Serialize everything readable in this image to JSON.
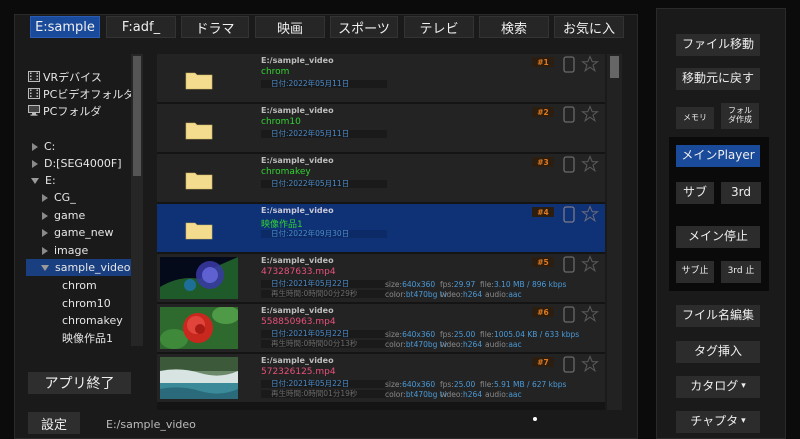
{
  "tabs": [
    {
      "label": "E:sample",
      "active": true
    },
    {
      "label": "F:adf_",
      "active": false
    },
    {
      "label": "ドラマ",
      "active": false
    },
    {
      "label": "映画",
      "active": false
    },
    {
      "label": "スポーツ",
      "active": false
    },
    {
      "label": "テレビ",
      "active": false
    },
    {
      "label": "検索",
      "active": false
    },
    {
      "label": "お気に入",
      "active": false
    }
  ],
  "tree": {
    "devices": [
      {
        "label": "VRデバイス",
        "icon": "film-icon"
      },
      {
        "label": "PCビデオフォルダ",
        "icon": "film-icon"
      },
      {
        "label": "PCフォルダ",
        "icon": "monitor-icon"
      }
    ],
    "drives": [
      "C:",
      "D:[SEG4000F]",
      "E:"
    ],
    "e_children": [
      "CG_",
      "game",
      "game_new",
      "image",
      "sample_video"
    ],
    "sample_video_children": [
      "chrom",
      "chrom10",
      "chromakey",
      "映像作品1"
    ]
  },
  "left_buttons": {
    "quit": "アプリ終了",
    "settings": "設定"
  },
  "current_path": "E:/sample_video",
  "files": [
    {
      "type": "folder",
      "path": "E:/sample_video",
      "name": "chrom",
      "date": "日付:2022年05月11日",
      "number": "#1"
    },
    {
      "type": "folder",
      "path": "E:/sample_video",
      "name": "chrom10",
      "date": "日付:2022年05月11日",
      "number": "#2"
    },
    {
      "type": "folder",
      "path": "E:/sample_video",
      "name": "chromakey",
      "date": "日付:2022年05月11日",
      "number": "#3"
    },
    {
      "type": "folder",
      "path": "E:/sample_video",
      "name": "映像作品1",
      "date": "日付:2022年09月30日",
      "number": "#4"
    },
    {
      "type": "video",
      "path": "E:/sample_video",
      "name": "473287633.mp4",
      "date": "日付:2021年05月22日",
      "duration": "再生時間:0時間00分29秒",
      "number": "#5",
      "size_label": "size:",
      "size": "640x360",
      "fps_label": "fps:",
      "fps": "29.97",
      "file_label": "file:",
      "file": "3.10 MB / 896 kbps",
      "color_label": "color:",
      "color": "bt470bg tv",
      "video_label": "video:",
      "video": "h264",
      "audio_label": "audio:",
      "audio": "aac"
    },
    {
      "type": "video",
      "path": "E:/sample_video",
      "name": "558850963.mp4",
      "date": "日付:2021年05月22日",
      "duration": "再生時間:0時間00分13秒",
      "number": "#6",
      "size_label": "size:",
      "size": "640x360",
      "fps_label": "fps:",
      "fps": "25.00",
      "file_label": "file:",
      "file": "1005.04 KB / 633 kbps",
      "color_label": "color:",
      "color": "bt470bg tv",
      "video_label": "video:",
      "video": "h264",
      "audio_label": "audio:",
      "audio": "aac"
    },
    {
      "type": "video",
      "path": "E:/sample_video",
      "name": "572326125.mp4",
      "date": "日付:2021年05月22日",
      "duration": "再生時間:0時間01分19秒",
      "number": "#7",
      "size_label": "size:",
      "size": "640x360",
      "fps_label": "fps:",
      "fps": "25.00",
      "file_label": "file:",
      "file": "5.91 MB / 627 kbps",
      "color_label": "color:",
      "color": "bt470bg tv",
      "video_label": "video:",
      "video": "h264",
      "audio_label": "audio:",
      "audio": "aac"
    }
  ],
  "right_buttons": {
    "move_file": "ファイル移動",
    "return_to_source": "移動元に戻す",
    "memo": "メモリ",
    "create_folder": "フォル\nダ作成",
    "main_player": "メインPlayer",
    "sub": "サブ",
    "third": "3rd",
    "main_stop": "メイン停止",
    "sub_stop": "サブ止",
    "third_stop": "3rd 止",
    "edit_filename": "フイル名編集",
    "insert_tag": "タグ挿入",
    "catalog": "カタログ",
    "chapter": "チャプタ"
  },
  "colors": {
    "accent_blue": "#1a4a9a",
    "selected_row": "#0f3175",
    "folder_name": "#32d232",
    "video_name": "#e8507a",
    "badge_text": "#e07a20"
  }
}
